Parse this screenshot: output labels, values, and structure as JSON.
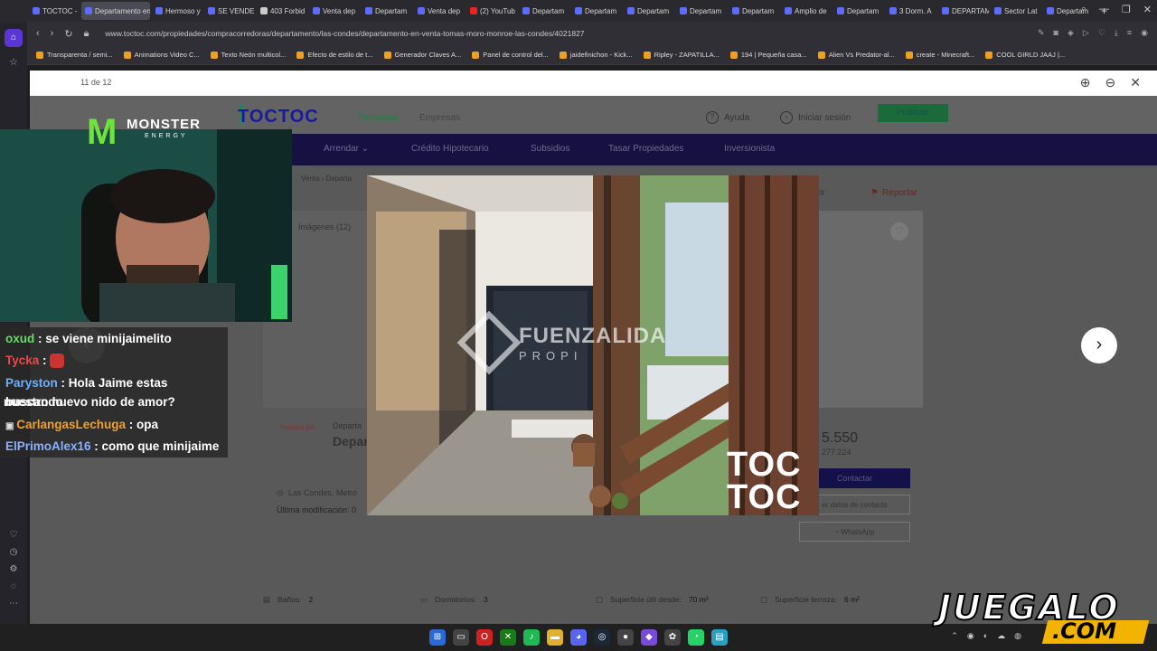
{
  "browser": {
    "tabs": [
      {
        "label": "TOCTOC -",
        "icon": "toctoc"
      },
      {
        "label": "Departamento en",
        "icon": "toctoc",
        "active": true
      },
      {
        "label": "Hermoso y",
        "icon": "toctoc"
      },
      {
        "label": "SE VENDE",
        "icon": "toctoc"
      },
      {
        "label": "403 Forbid",
        "icon": "doc"
      },
      {
        "label": "Venta dep",
        "icon": "toctoc"
      },
      {
        "label": "Departam",
        "icon": "toctoc"
      },
      {
        "label": "Venta dep",
        "icon": "toctoc"
      },
      {
        "label": "(2) YouTub",
        "icon": "youtube"
      },
      {
        "label": "Departam",
        "icon": "toctoc"
      },
      {
        "label": "Departam",
        "icon": "toctoc"
      },
      {
        "label": "Departam",
        "icon": "toctoc"
      },
      {
        "label": "Departam",
        "icon": "toctoc"
      },
      {
        "label": "Departam",
        "icon": "toctoc"
      },
      {
        "label": "Amplio de",
        "icon": "toctoc"
      },
      {
        "label": "Departam",
        "icon": "toctoc"
      },
      {
        "label": "3 Dorm. A",
        "icon": "toctoc"
      },
      {
        "label": "DEPARTAM",
        "icon": "toctoc"
      },
      {
        "label": "Sector Lat",
        "icon": "toctoc"
      },
      {
        "label": "Departam",
        "icon": "toctoc"
      }
    ],
    "url": "www.toctoc.com/propiedades/compracorredoras/departamento/las-condes/departamento-en-venta-tomas-moro-monroe-las-condes/4021827",
    "bookmarks": [
      "Transparenta / semi...",
      "Animations Video C...",
      "Texto Neón multicol...",
      "Efecto de estilo de t...",
      "Generador Claves A...",
      "Panel de control del...",
      "jaidefinichon - Kick...",
      "Ripley - ZAPATILLA...",
      "194 | Pequeña casa...",
      "Alien Vs Predator-al...",
      "create - Minecraft...",
      "COOL GIRLD JAAJ |..."
    ]
  },
  "lightbox": {
    "counter": "11 de 12"
  },
  "site": {
    "logo": "TOCTOC",
    "nav_personas": "Personas",
    "nav_empresas": "Empresas",
    "help": "Ayuda",
    "login": "Iniciar sesión",
    "publish": "Publicar",
    "menu": [
      "Arrendar ⌄",
      "Crédito Hipotecario",
      "Subsidios",
      "Tasar Propiedades",
      "Inversionista"
    ],
    "breadcrumb": "Venta  ›  Departa",
    "images_label": "Imágenes  (12)",
    "share": "rtir",
    "report": "Reportar",
    "listing_type": "Departa",
    "listing_title": "Depar",
    "agency": "FUENZALIDA",
    "price_uf": "5.550",
    "price_clp": "277.224",
    "contact_btn": "Contactar",
    "contact_data_btn": "er datos de contacto",
    "whatsapp_btn": "WhatsApp",
    "location": "Las Condes, Metro",
    "last_modified": "Última modificación: 0",
    "features": [
      {
        "label": "Baños:",
        "value": "2"
      },
      {
        "label": "Dormitorios:",
        "value": "3"
      },
      {
        "label": "Superficie útil desde:",
        "value": "70 m²"
      },
      {
        "label": "Superficie terraza:",
        "value": "6 m²"
      }
    ]
  },
  "photo": {
    "watermark_main": "FUENZALIDA",
    "watermark_sub": "PROPI",
    "brand_top": "TOC",
    "brand_bottom": "TOC"
  },
  "stream": {
    "sponsor_top": "MONSTER",
    "sponsor_bottom": "ENERGY",
    "chat": [
      {
        "user": "oxud",
        "text": " : se viene minijaimelito"
      },
      {
        "user": "Tycka",
        "text": " : "
      },
      {
        "user": "Paryston",
        "text": " : Hola Jaime estas buscando"
      },
      {
        "user": "",
        "text": "nuestro nuevo nido de amor?"
      },
      {
        "user": "CarlangasLechuga",
        "text": " : opa"
      },
      {
        "user": "ElPrimoAlex16",
        "text": " : como que minijaime"
      }
    ],
    "overlay_brand_top": "JUEGALO",
    "overlay_brand_bottom": ".COM"
  },
  "colors": {
    "toctoc_blue": "#1a1aa0",
    "toctoc_green": "#1b8a5f",
    "nav_purple": "#161140",
    "opera_red": "#e33333"
  }
}
